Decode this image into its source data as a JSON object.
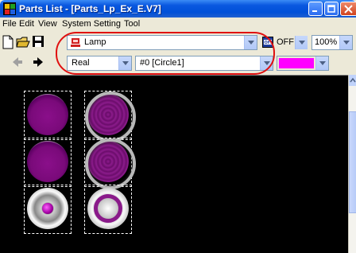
{
  "window": {
    "title": "Parts List - [Parts_Lp_Ex_E.V7]"
  },
  "menu": [
    "File",
    "Edit",
    "View",
    "System Setting",
    "Tool"
  ],
  "toolbar": {
    "part_type": "Lamp",
    "state": "OFF",
    "zoom": "100%",
    "style": "Real",
    "item": "#0 [Circle1]",
    "color": "#ff00ff"
  },
  "parts": [
    {
      "name": "lamp-flat",
      "col": 1,
      "row": 1
    },
    {
      "name": "lamp-rings",
      "col": 2,
      "row": 1
    },
    {
      "name": "lamp-flat",
      "col": 1,
      "row": 2
    },
    {
      "name": "lamp-rings",
      "col": 2,
      "row": 2
    },
    {
      "name": "lamp-metal-dot",
      "col": 1,
      "row": 3
    },
    {
      "name": "lamp-metal-ring",
      "col": 2,
      "row": 3
    }
  ],
  "icons": [
    "app-icon",
    "new-file-icon",
    "open-folder-icon",
    "save-icon",
    "back-arrow-icon",
    "forward-arrow-icon",
    "lamp-part-icon",
    "off-state-icon"
  ]
}
